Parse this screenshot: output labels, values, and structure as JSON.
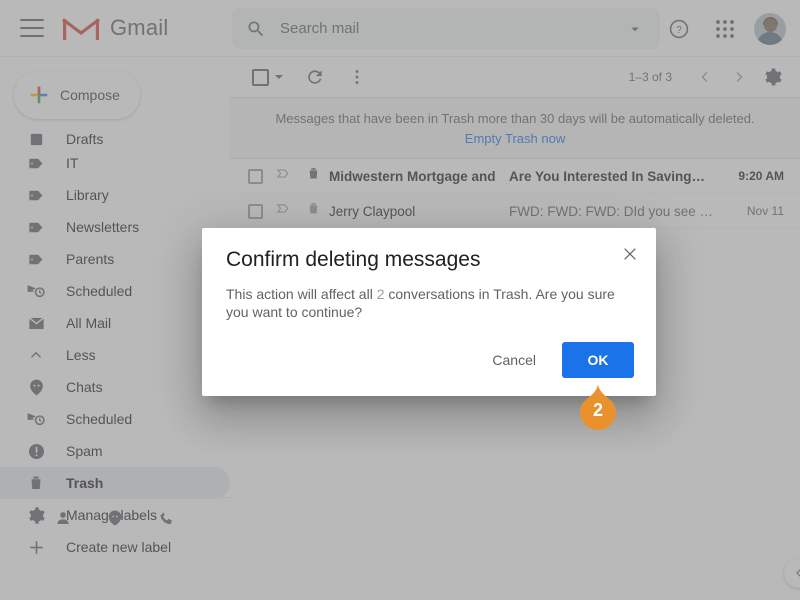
{
  "header": {
    "menu_icon": "hamburger-icon",
    "logo_icon": "gmail-logo-icon",
    "brand": "Gmail",
    "search": {
      "icon": "search-icon",
      "value": "",
      "placeholder": "Search mail",
      "options_icon": "chevron-down-icon"
    },
    "help_icon": "help-icon",
    "apps_icon": "apps-grid-icon",
    "avatar_icon": "account-avatar"
  },
  "sidebar": {
    "compose": {
      "label": "Compose",
      "icon": "plus-icon"
    },
    "items": [
      {
        "label": "Drafts",
        "icon": "draft-icon",
        "selected": false,
        "clipped": true
      },
      {
        "label": "IT",
        "icon": "label-tag-icon",
        "selected": false
      },
      {
        "label": "Library",
        "icon": "label-tag-icon",
        "selected": false
      },
      {
        "label": "Newsletters",
        "icon": "label-tag-icon",
        "selected": false
      },
      {
        "label": "Parents",
        "icon": "label-tag-icon",
        "selected": false
      },
      {
        "label": "Scheduled",
        "icon": "scheduled-icon",
        "selected": false
      },
      {
        "label": "All Mail",
        "icon": "all-mail-icon",
        "selected": false
      },
      {
        "label": "Less",
        "icon": "chevron-up-icon",
        "selected": false
      },
      {
        "label": "Chats",
        "icon": "chat-icon",
        "selected": false
      },
      {
        "label": "Scheduled",
        "icon": "scheduled-icon",
        "selected": false
      },
      {
        "label": "Spam",
        "icon": "spam-icon",
        "selected": false
      },
      {
        "label": "Trash",
        "icon": "trash-icon",
        "selected": true
      },
      {
        "label": "Manage labels",
        "icon": "gear-icon",
        "selected": false
      },
      {
        "label": "Create new label",
        "icon": "plus-icon",
        "selected": false
      }
    ],
    "footer_icons": [
      "person-icon",
      "hangouts-icon",
      "phone-icon"
    ]
  },
  "toolbar": {
    "select_all_icon": "checkbox-icon",
    "select_all_caret_icon": "chevron-down-icon",
    "refresh_icon": "refresh-icon",
    "more_icon": "more-vertical-icon",
    "count": "1–3 of 3",
    "prev_icon": "chevron-left-icon",
    "next_icon": "chevron-right-icon",
    "settings_icon": "gear-icon"
  },
  "banner": {
    "message": "Messages that have been in Trash more than 30 days will be automatically deleted.",
    "action": "Empty Trash now"
  },
  "messages": [
    {
      "sender": "Midwestern Mortgage and",
      "subject": "Are You Interested In Saving…",
      "date": "9:20 AM",
      "unread": true
    },
    {
      "sender": "Jerry Claypool",
      "subject": "FWD: FWD: FWD: DId you see …",
      "date": "Nov 11",
      "unread": false
    }
  ],
  "collapse_button_icon": "chevron-left-icon",
  "dialog": {
    "title": "Confirm deleting messages",
    "close_icon": "close-icon",
    "body_before": "This action will affect all",
    "body_count": "2",
    "body_after": "conversations in Trash. Are you sure you want to continue?",
    "cancel_label": "Cancel",
    "ok_label": "OK"
  },
  "marker": {
    "step": "2",
    "color": "#e8912d"
  },
  "colors": {
    "accent_blue": "#1a73e8",
    "link_blue": "#1a73e8",
    "text_primary": "#202124",
    "text_secondary": "#5f6368",
    "marker_orange": "#e8912d",
    "scrim": "rgba(128,128,128,0.55)"
  }
}
